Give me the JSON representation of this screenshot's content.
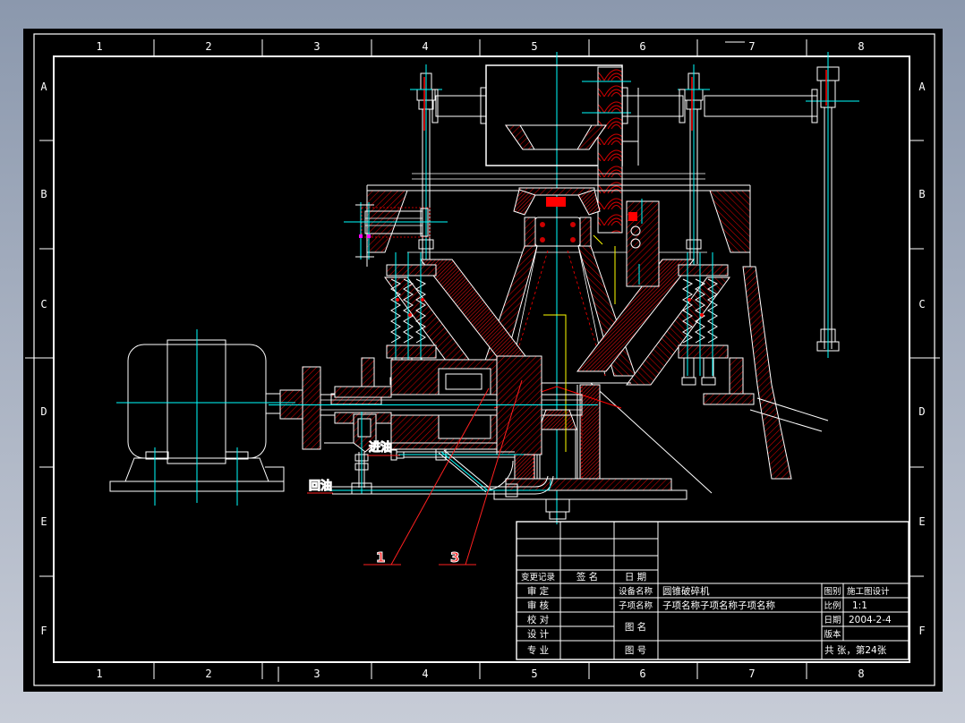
{
  "frame": {
    "columns": [
      "1",
      "2",
      "3",
      "4",
      "5",
      "6",
      "7",
      "8"
    ],
    "rows": [
      "A",
      "B",
      "C",
      "D",
      "E",
      "F"
    ]
  },
  "annotations": {
    "oil_inlet": "进油",
    "oil_return": "回油",
    "callout_1": "1",
    "callout_3": "3"
  },
  "title_block": {
    "change_record": "变更记录",
    "signature": "签 名",
    "date_header": "日 期",
    "approved": "审 定",
    "checked": "审 核",
    "proofread": "校 对",
    "designed": "设 计",
    "specialty": "专 业",
    "equipment_name_label": "设备名称",
    "equipment_name": "圆锥破碎机",
    "subitem_label": "子项名称",
    "subitem_name": "子项名称子项名称子项名称",
    "drawing_name_label": "图 名",
    "drawing_no_label": "图 号",
    "category_label": "图别",
    "category": "施工图设计",
    "scale_label": "比例",
    "scale": "1:1",
    "date_label": "日期",
    "date": "2004-2-4",
    "version_label": "版本",
    "sheet_info": "共 张，第24张"
  },
  "colors": {
    "line_white": "#ffffff",
    "hatch_red": "#ff0000",
    "centerline_cyan": "#00ffff",
    "highlight_yellow": "#ffff00",
    "marker_magenta": "#ff00ff",
    "paper_black": "#000000",
    "backdrop_top": "#8b98ad",
    "backdrop_bottom": "#c7ccd7"
  }
}
